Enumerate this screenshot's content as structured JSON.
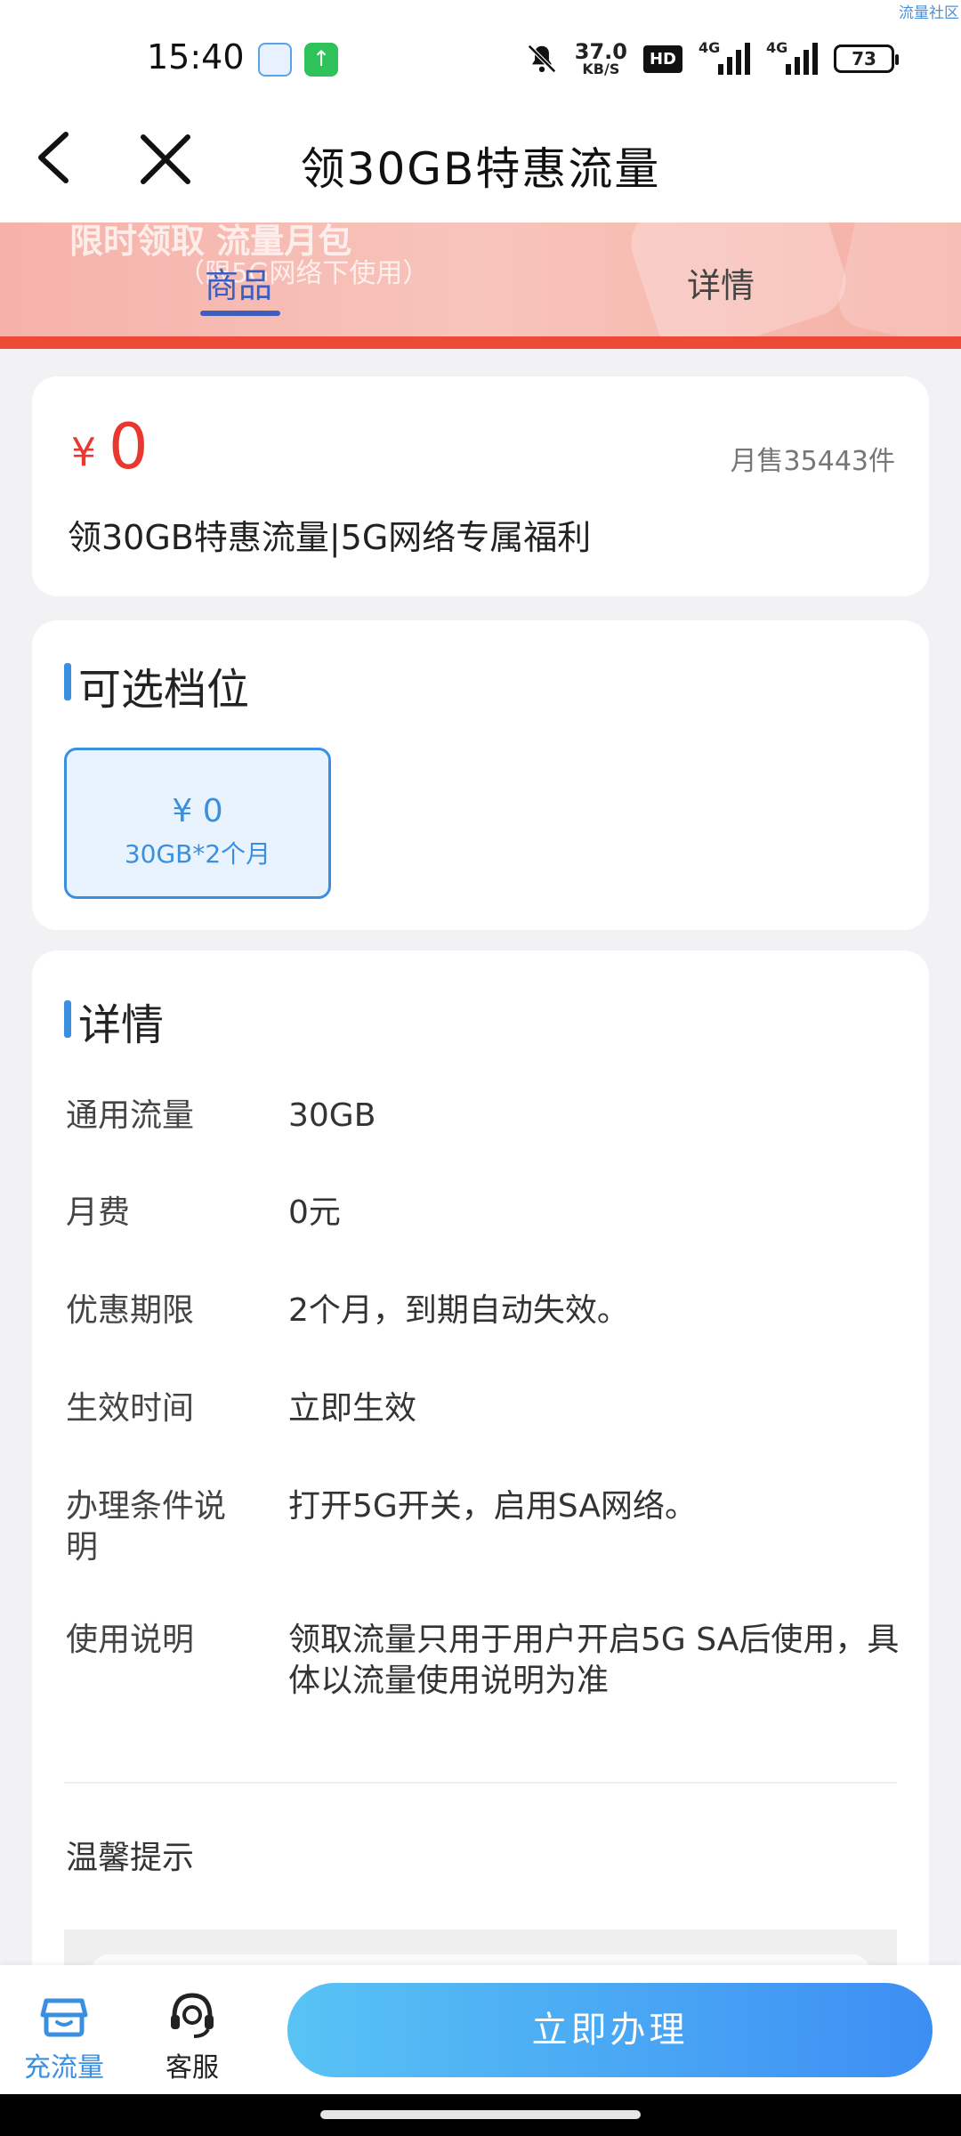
{
  "status_bar": {
    "time": "15:40",
    "net_speed_value": "37.0",
    "net_speed_unit": "KB/S",
    "hd_label": "HD",
    "signal1_label": "4G",
    "signal2_label": "4G",
    "battery": "73",
    "watermark": "流量社区"
  },
  "nav": {
    "title": "领30GB特惠流量"
  },
  "banner": {
    "bg_text_1": "限时领取 流量月包",
    "bg_text_2": "（限5G网络下使用）",
    "tabs": [
      {
        "label": "商品",
        "active": true
      },
      {
        "label": "详情",
        "active": false
      }
    ]
  },
  "product": {
    "currency": "¥",
    "price": "0",
    "monthly_sales": "月售35443件",
    "name": "领30GB特惠流量|5G网络专属福利"
  },
  "tiers": {
    "title": "可选档位",
    "options": [
      {
        "price": "¥ 0",
        "desc": "30GB*2个月",
        "selected": true
      }
    ]
  },
  "detail": {
    "title": "详情",
    "rows": [
      {
        "key": "通用流量",
        "value": "30GB"
      },
      {
        "key": "月费",
        "value": "0元"
      },
      {
        "key": "优惠期限",
        "value": "2个月，到期自动失效。"
      },
      {
        "key": "生效时间",
        "value": "立即生效"
      },
      {
        "key": "办理条件说明",
        "value": "打开5G开关，启用SA网络。"
      },
      {
        "key": "使用说明",
        "value": "领取流量只用于用户开启5G SA后使用，具体以流量使用说明为准"
      }
    ],
    "tips_title": "温馨提示"
  },
  "bottom_bar": {
    "recharge_label": "充流量",
    "service_label": "客服",
    "cta_label": "立即办理"
  },
  "colors": {
    "accent_blue": "#3a8fe0",
    "price_red": "#e8382f",
    "banner_red": "#ec4a34"
  }
}
